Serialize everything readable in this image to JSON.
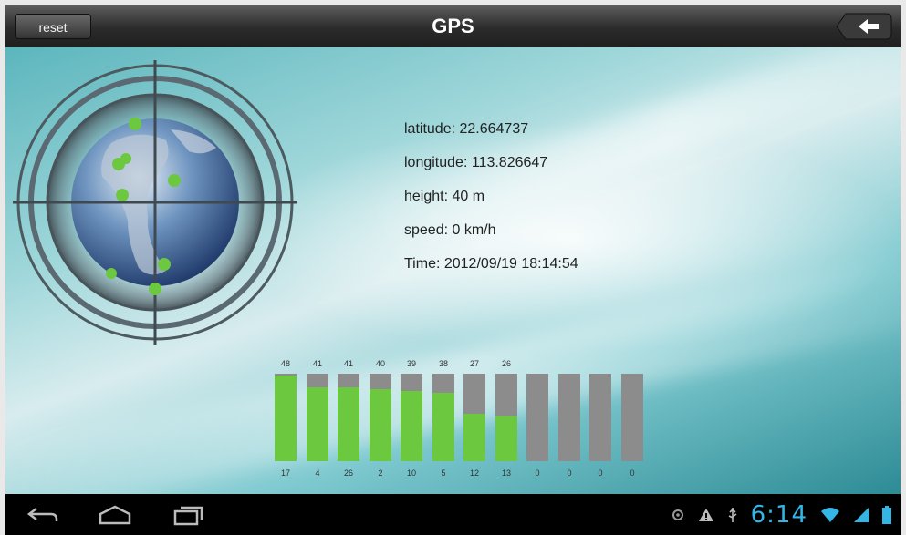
{
  "header": {
    "title": "GPS",
    "reset_label": "reset",
    "back_icon": "back-arrow-icon"
  },
  "info": {
    "latitude": "latitude: 22.664737",
    "longitude": "longitude: 113.826647",
    "height": "height: 40 m",
    "speed": "speed: 0 km/h",
    "time": "Time: 2012/09/19  18:14:54"
  },
  "satellites": [
    {
      "signal": "48",
      "id": "17",
      "level": 0.98
    },
    {
      "signal": "41",
      "id": "4",
      "level": 0.84
    },
    {
      "signal": "41",
      "id": "26",
      "level": 0.84
    },
    {
      "signal": "40",
      "id": "2",
      "level": 0.82
    },
    {
      "signal": "39",
      "id": "10",
      "level": 0.8
    },
    {
      "signal": "38",
      "id": "5",
      "level": 0.78
    },
    {
      "signal": "27",
      "id": "12",
      "level": 0.54
    },
    {
      "signal": "26",
      "id": "13",
      "level": 0.52
    },
    {
      "signal": "",
      "id": "0",
      "level": 0
    },
    {
      "signal": "",
      "id": "0",
      "level": 0
    },
    {
      "signal": "",
      "id": "0",
      "level": 0
    },
    {
      "signal": "",
      "id": "0",
      "level": 0
    }
  ],
  "statusbar": {
    "clock": "6:14",
    "icons": [
      "gps-icon",
      "warning-icon",
      "usb-icon",
      "wifi-icon",
      "signal-icon",
      "battery-icon"
    ],
    "nav": [
      "back-icon",
      "home-icon",
      "recent-apps-icon"
    ]
  },
  "colors": {
    "signal_bar_fill": "#6cc83f",
    "signal_bar_empty": "#8c8c8c",
    "clock": "#33b5e5"
  }
}
